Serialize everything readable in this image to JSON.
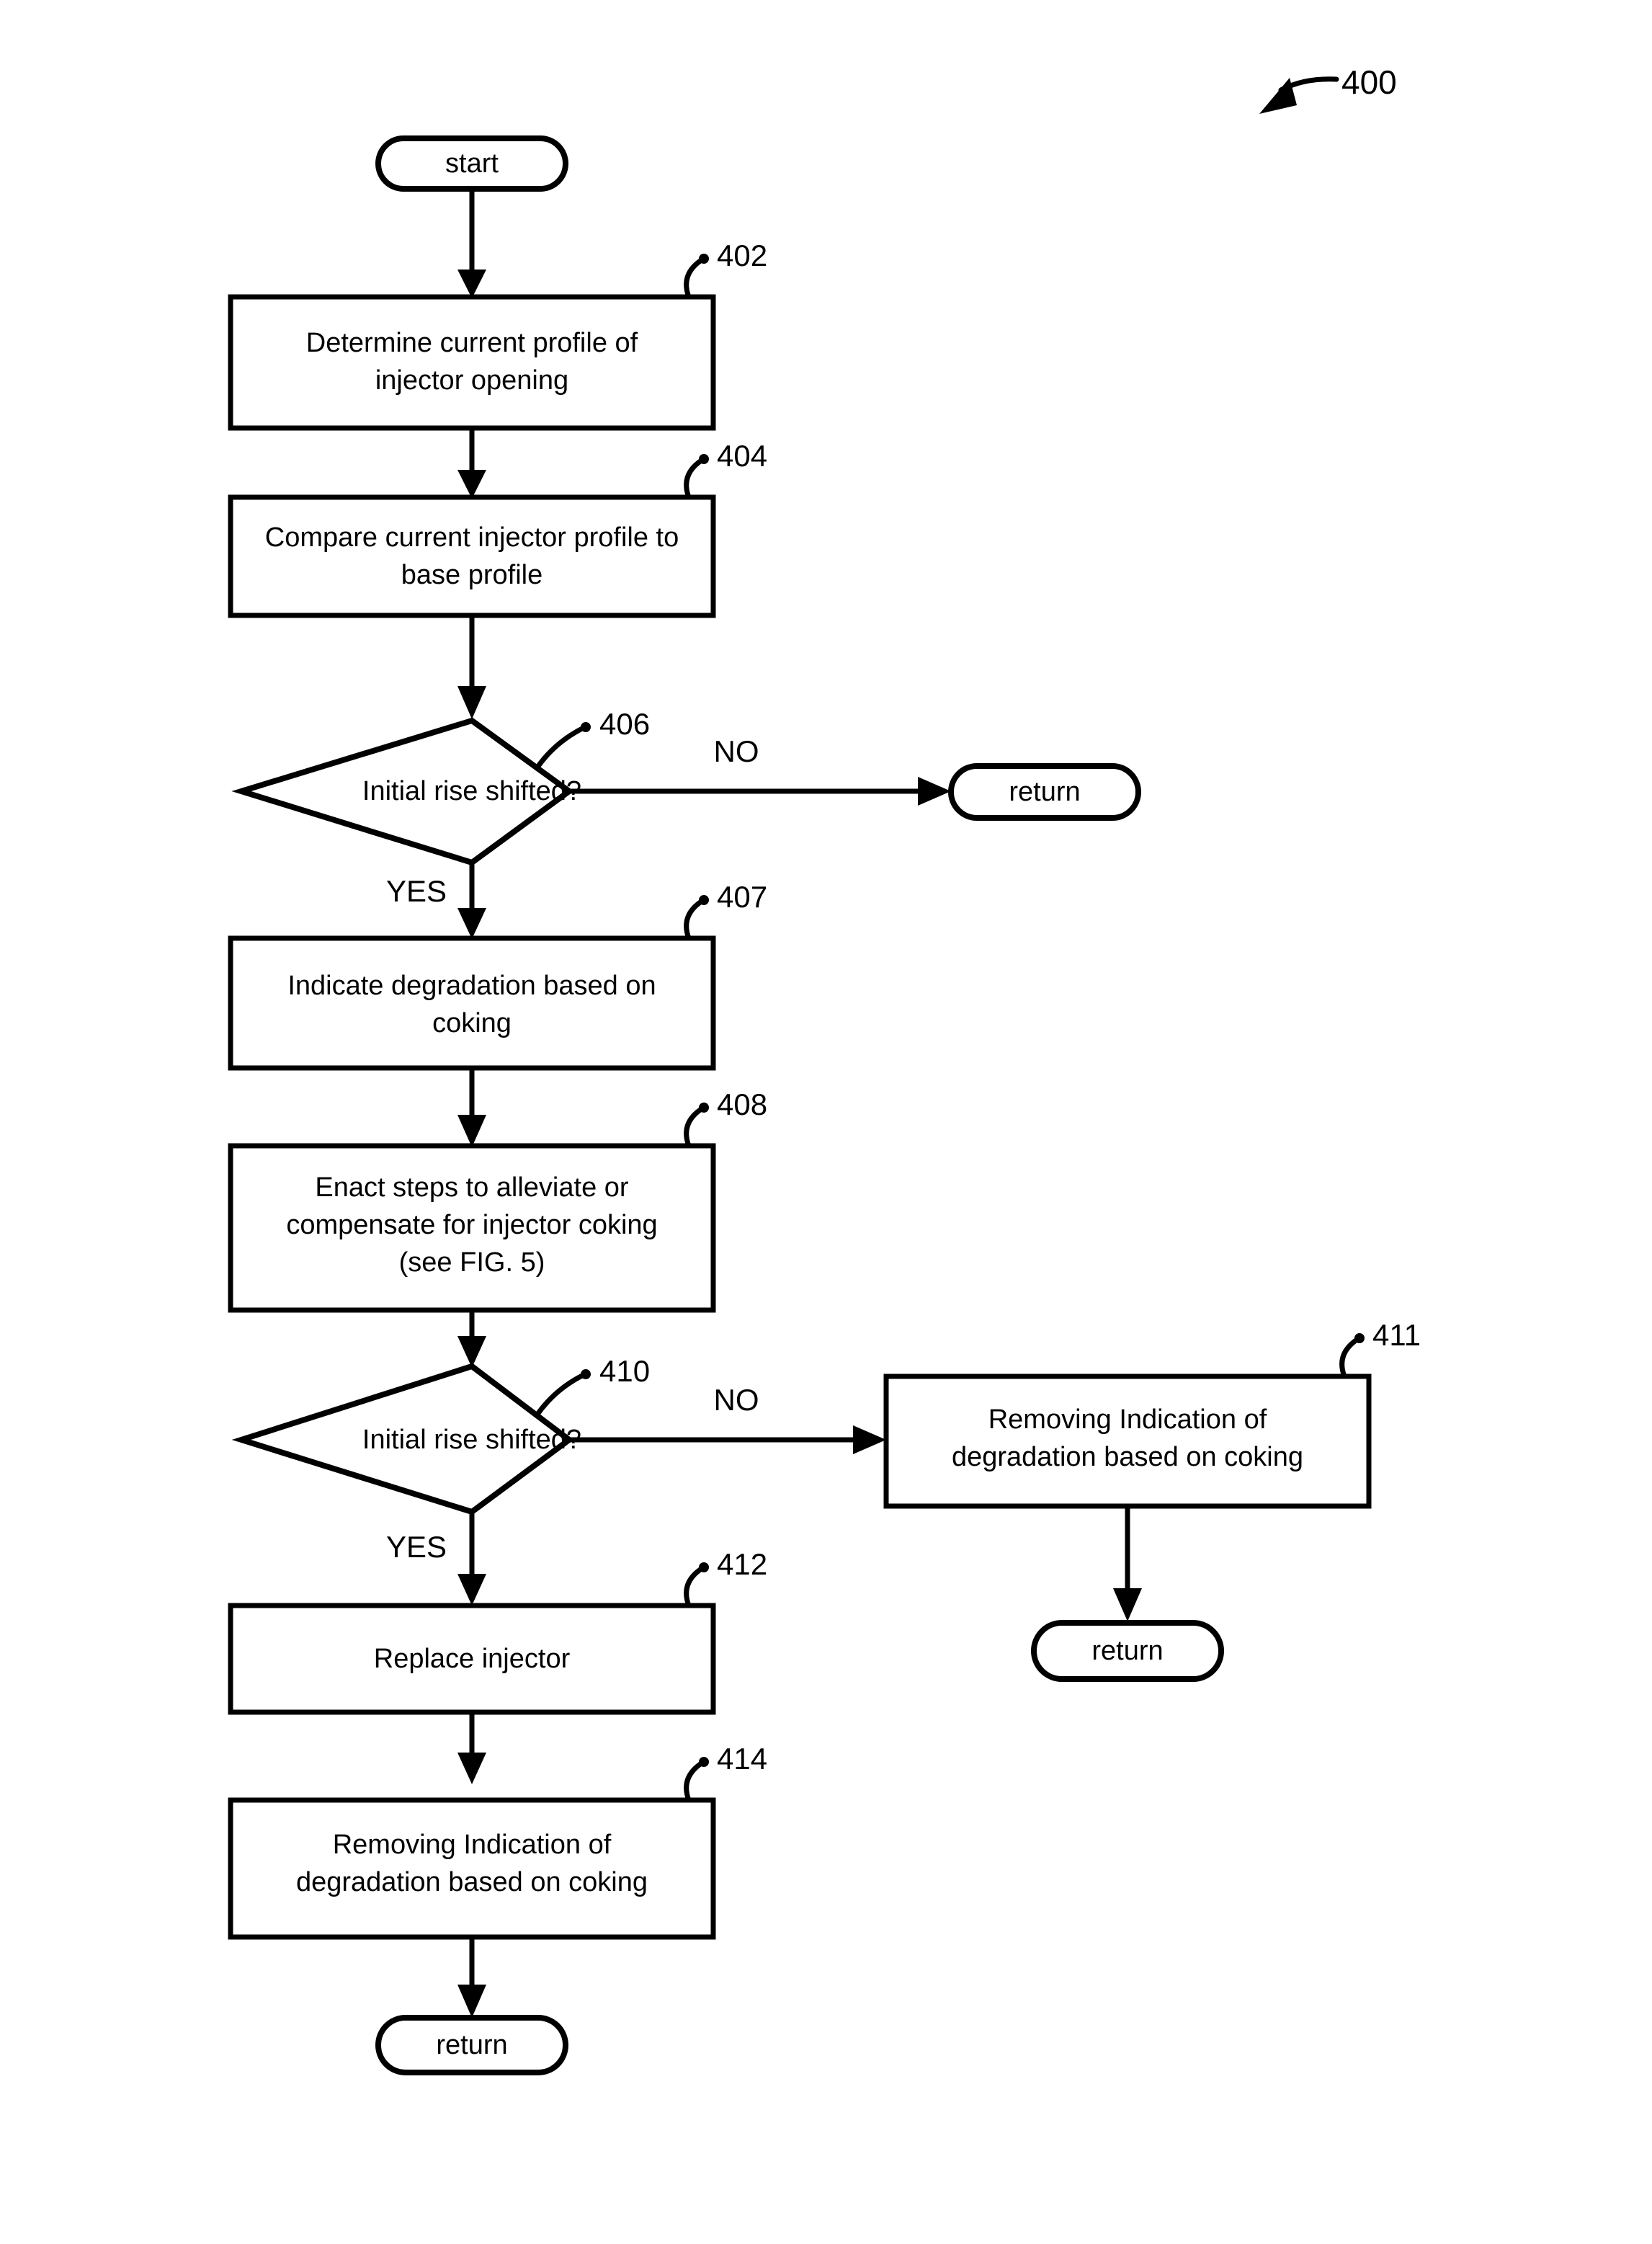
{
  "figure": {
    "number": "400",
    "type": "flowchart"
  },
  "nodes": {
    "start": {
      "label": "start"
    },
    "step_402": {
      "ref": "402",
      "lines": [
        "Determine current profile of",
        "injector opening"
      ]
    },
    "step_404": {
      "ref": "404",
      "lines": [
        "Compare current injector profile to",
        "base profile"
      ]
    },
    "decision_406": {
      "ref": "406",
      "lines": [
        "Initial rise shifted?"
      ],
      "yes_label": "YES",
      "no_label": "NO"
    },
    "return_406_no": {
      "label": "return"
    },
    "step_407": {
      "ref": "407",
      "lines": [
        "Indicate degradation based on",
        "coking"
      ]
    },
    "step_408": {
      "ref": "408",
      "lines": [
        "Enact steps to alleviate or",
        "compensate for injector coking",
        "(see FIG. 5)"
      ]
    },
    "decision_410": {
      "ref": "410",
      "lines": [
        "Initial rise shifted?"
      ],
      "yes_label": "YES",
      "no_label": "NO"
    },
    "step_411": {
      "ref": "411",
      "lines": [
        "Removing Indication of",
        "degradation based on coking"
      ]
    },
    "return_411": {
      "label": "return"
    },
    "step_412": {
      "ref": "412",
      "lines": [
        "Replace injector"
      ]
    },
    "step_414": {
      "ref": "414",
      "lines": [
        "Removing Indication of",
        "degradation based on coking"
      ]
    },
    "return_414": {
      "label": "return"
    }
  },
  "colors": {
    "stroke": "#000000",
    "fill": "#ffffff",
    "text": "#000000"
  }
}
